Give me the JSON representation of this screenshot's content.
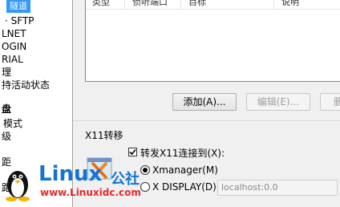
{
  "tree": {
    "selected": "隧道",
    "items": [
      "SFTP",
      "LNET",
      "OGIN",
      "RIAL",
      "理",
      "持活动状态",
      "盘",
      "模式",
      "级",
      "距",
      "距"
    ]
  },
  "table": {
    "columns": [
      "类型",
      "侦听端口",
      "目标",
      "说明"
    ]
  },
  "buttons": {
    "add": "添加(A)...",
    "edit": "编辑(E)...",
    "delete": "删"
  },
  "x11": {
    "title": "X11转移",
    "forward_label": "转发X11连接到(X):",
    "forward_checked": true,
    "xmanager_label": "Xmanager(M)",
    "xmanager_selected": true,
    "display_label": "X DISPLAY(D):",
    "display_value": "localhost:0.0"
  },
  "watermark": {
    "brand": "Linux",
    "cn": "公社",
    "url": "www.Linuxidc.com"
  }
}
